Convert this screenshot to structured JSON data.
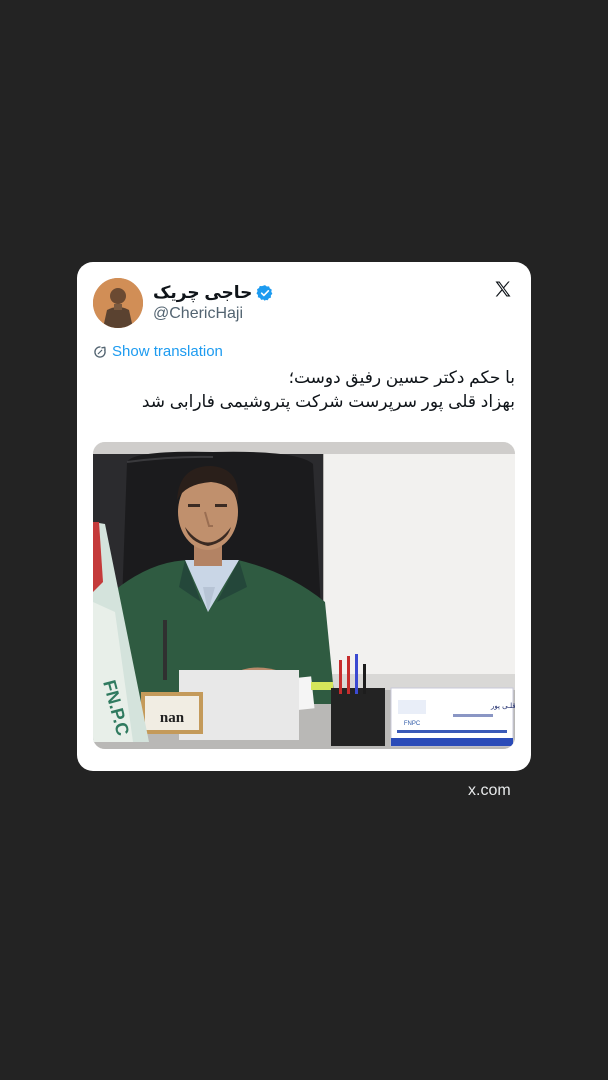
{
  "tweet": {
    "display_name": "حاجی چریک",
    "handle": "@ChericHaji",
    "show_translation": "Show translation",
    "text_lines": [
      "با حکم دکتر حسین رفیق دوست؛",
      "بهزاد قلی پور سرپرست شرکت پتروشیمی فارابی شد"
    ]
  },
  "media": {
    "flag_text": "FN.P.C",
    "desk_sign": "nan",
    "nameplate_name": "بهـزاد قلـی پور",
    "nameplate_logo": "FNPC"
  },
  "footer": {
    "domain": "x.com"
  },
  "colors": {
    "background": "#232323",
    "card": "#ffffff",
    "link": "#1d9bf0",
    "verified": "#1d9bf0"
  },
  "icons": [
    "verified-badge-icon",
    "x-logo-icon",
    "translate-icon"
  ]
}
